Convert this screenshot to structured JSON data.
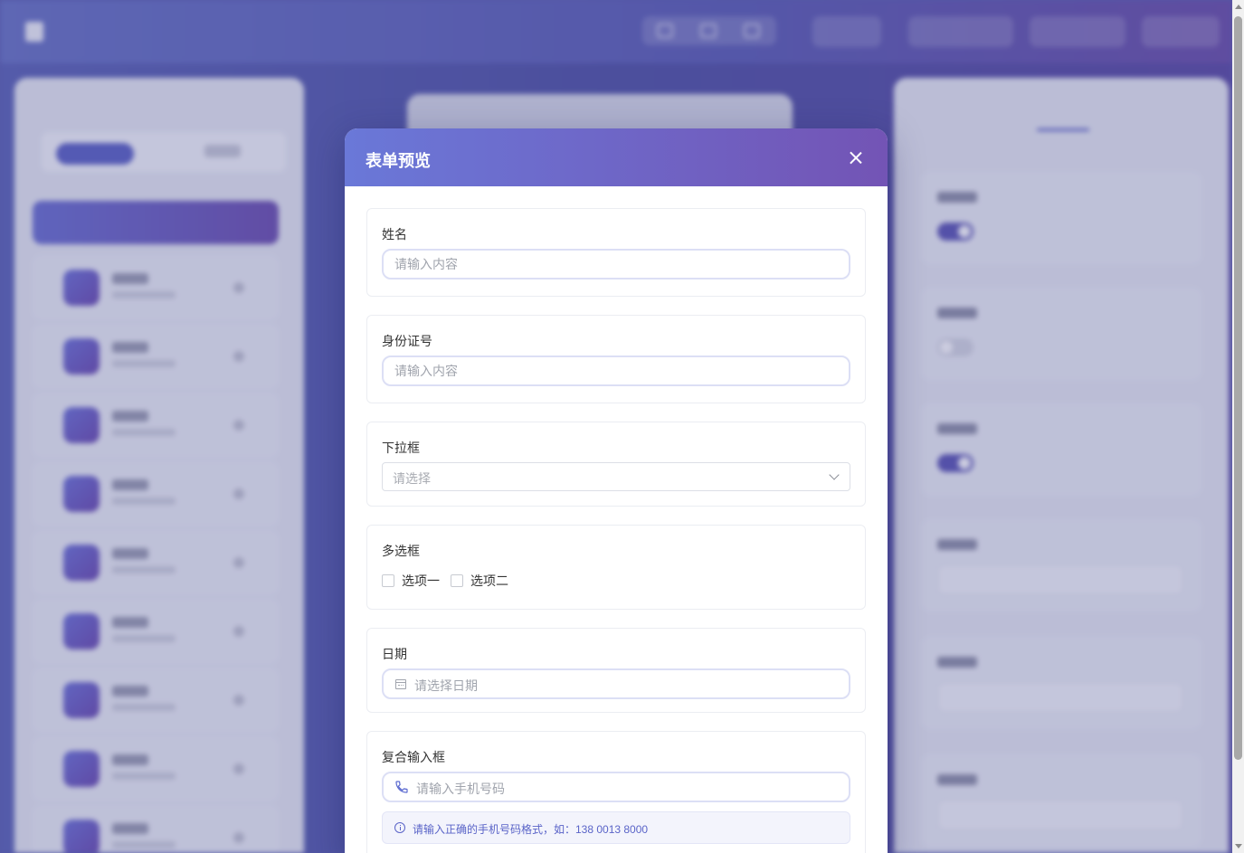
{
  "modal": {
    "title": "表单预览",
    "fields": [
      {
        "label": "姓名",
        "placeholder": "请输入内容"
      },
      {
        "label": "身份证号",
        "placeholder": "请输入内容"
      },
      {
        "label": "下拉框",
        "placeholder": "请选择"
      },
      {
        "label": "多选框",
        "options": [
          "选项一",
          "选项二"
        ]
      },
      {
        "label": "日期",
        "placeholder": "请选择日期"
      },
      {
        "label": "复合输入框",
        "placeholder": "请输入手机号码",
        "hint": "请输入正确的手机号码格式，如：138 0013 8000"
      }
    ]
  },
  "colors": {
    "header_gradient_start": "#6a78d8",
    "header_gradient_end": "#7354b5",
    "accent": "#5a64c8"
  },
  "icons": {
    "close": "close-icon",
    "select": "chevron-down-icon",
    "date": "calendar-icon",
    "phone": "phone-icon",
    "hint": "info-icon"
  }
}
